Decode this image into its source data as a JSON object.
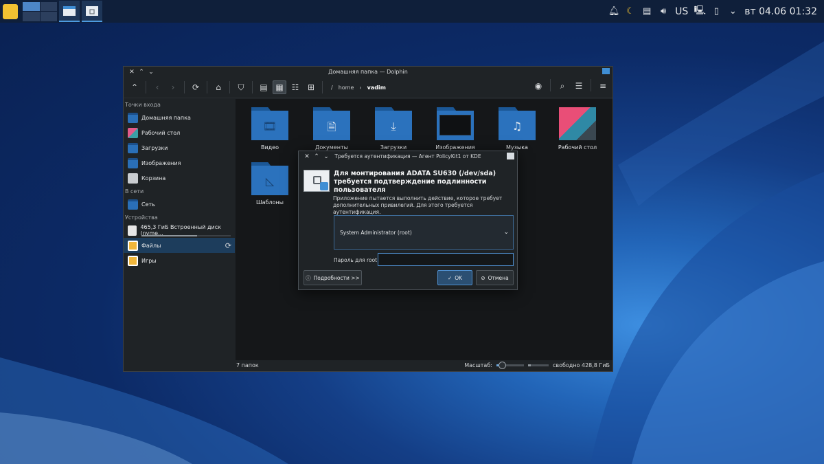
{
  "panel": {
    "tray_icons": [
      "bell-icon",
      "night-color-icon",
      "clipboard-icon",
      "volume-icon"
    ],
    "keyboard_layout": "US",
    "clock": "вт 04.06 01:32"
  },
  "dolphin": {
    "title": "Домашняя папка — Dolphin",
    "breadcrumb": {
      "root": "/",
      "home": "home",
      "current": "vadim"
    },
    "sidebar": {
      "places_title": "Точки входа",
      "places": [
        "Домашняя папка",
        "Рабочий стол",
        "Загрузки",
        "Изображения",
        "Корзина"
      ],
      "network_title": "В сети",
      "network": [
        "Сеть"
      ],
      "devices_title": "Устройства",
      "devices": [
        "465,3 ГиБ Встроенный диск (nvme...",
        "Файлы",
        "Игры"
      ],
      "disk_usage_fraction": 0.62
    },
    "files": [
      {
        "name": "Видео",
        "icon": "film-icon"
      },
      {
        "name": "Документы",
        "icon": "document-icon"
      },
      {
        "name": "Загрузки",
        "icon": "download-icon"
      },
      {
        "name": "Изображения",
        "icon": "image-thumbnail"
      },
      {
        "name": "Музыка",
        "icon": "music-icon"
      },
      {
        "name": "Рабочий стол",
        "icon": "wallpaper-thumbnail"
      },
      {
        "name": "Шаблоны",
        "icon": "template-icon"
      }
    ],
    "status": {
      "count": "7 папок",
      "zoom_label": "Масштаб:",
      "zoom_fraction": 0.2,
      "free": "свободно 428,8 ГиБ",
      "free_fraction": 0.15
    }
  },
  "auth_dialog": {
    "title": "Требуется аутентификация — Агент PolicyKit1 от KDE",
    "heading": "Для монтирования ADATA SU630 (/dev/sda) требуется подтверждение подлинности пользователя",
    "description": "Приложение пытается выполнить действие, которое требует дополнительных привилегий. Для этого требуется аутентификация.",
    "user": "System Administrator (root)",
    "password_label": "Пароль для root:",
    "password_value": "",
    "details_button": "Подробности >>",
    "ok_button": "OK",
    "cancel_button": "Отмена"
  }
}
